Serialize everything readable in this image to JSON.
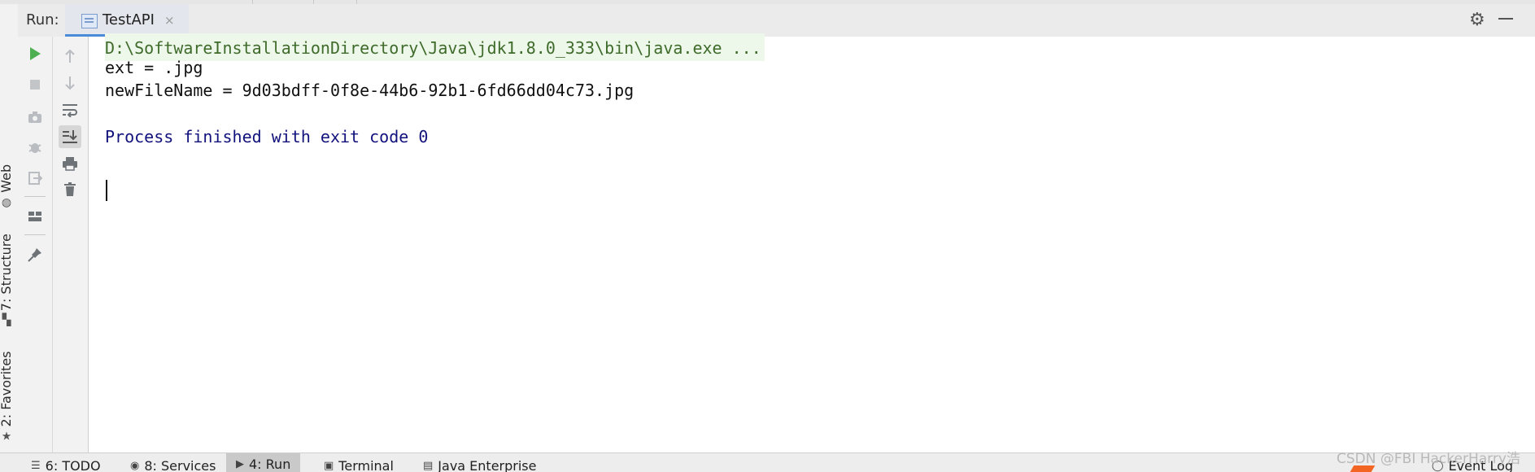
{
  "window": {
    "run_label": "Run:",
    "tab_title": "TestAPI",
    "tab_close": "×",
    "settings_icon": "gear-icon",
    "minimize_icon": "minimize-icon"
  },
  "left_strip": {
    "items": [
      {
        "label": "Web",
        "icon": "globe-icon"
      },
      {
        "label": "7: Structure",
        "icon": "structure-icon"
      },
      {
        "label": "2: Favorites",
        "icon": "star-icon"
      }
    ]
  },
  "console": {
    "command_line": "D:\\SoftwareInstallationDirectory\\Java\\jdk1.8.0_333\\bin\\java.exe ...",
    "lines": [
      "ext = .jpg",
      "newFileName = 9d03bdff-0f8e-44b6-92b1-6fd66dd04c73.jpg"
    ],
    "finished_message": "Process finished with exit code 0"
  },
  "bottom_bar": {
    "tabs": [
      {
        "label": "6: TODO",
        "icon": "list-icon"
      },
      {
        "label": "8: Services",
        "icon": "services-icon"
      },
      {
        "label": "4: Run",
        "icon": "run-icon",
        "active": true
      },
      {
        "label": "Terminal",
        "icon": "terminal-icon"
      },
      {
        "label": "Java Enterprise",
        "icon": "java-enterprise-icon"
      }
    ],
    "event_log": "Event Log"
  },
  "watermark": "CSDN @FBI HackerHarry浩",
  "colors": {
    "run_green": "#4caf50",
    "tab_underline": "#4a8ad7",
    "finished_text": "#12127c",
    "command_bg": "#edf7ea"
  }
}
